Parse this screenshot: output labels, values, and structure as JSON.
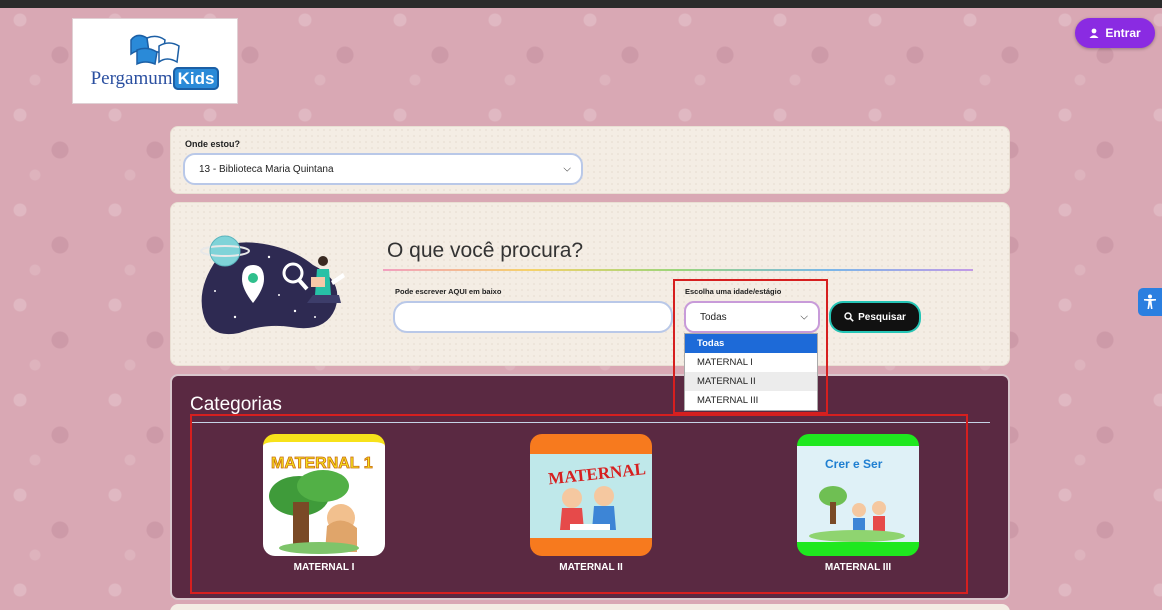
{
  "header": {
    "logo_text": "Pergamum",
    "logo_kids": "Kids",
    "login_label": "Entrar",
    "login_icon": "user-icon"
  },
  "location": {
    "label": "Onde estou?",
    "selected": "13 - Biblioteca Maria Quintana"
  },
  "search": {
    "title": "O que você procura?",
    "input_label": "Pode escrever AQUI em baixo",
    "input_value": "",
    "age_label": "Escolha uma idade/estágio",
    "age_selected": "Todas",
    "age_options": [
      "Todas",
      "MATERNAL I",
      "MATERNAL II",
      "MATERNAL III"
    ],
    "button_label": "Pesquisar",
    "button_icon": "search-icon"
  },
  "categories": {
    "title": "Categorias",
    "items": [
      {
        "label": "MATERNAL I",
        "cover_text": "MATERNAL 1"
      },
      {
        "label": "MATERNAL II",
        "cover_text": "MATERNAL"
      },
      {
        "label": "MATERNAL III",
        "cover_text": "Crer e Ser"
      }
    ]
  },
  "accessibility": {
    "icon": "accessibility-icon"
  },
  "colors": {
    "background": "#d9a8b4",
    "accent_purple": "#8a2be2",
    "categories_bg": "#5a2942",
    "highlight_red": "#d61f1f",
    "option_selected": "#1d6ad8"
  }
}
